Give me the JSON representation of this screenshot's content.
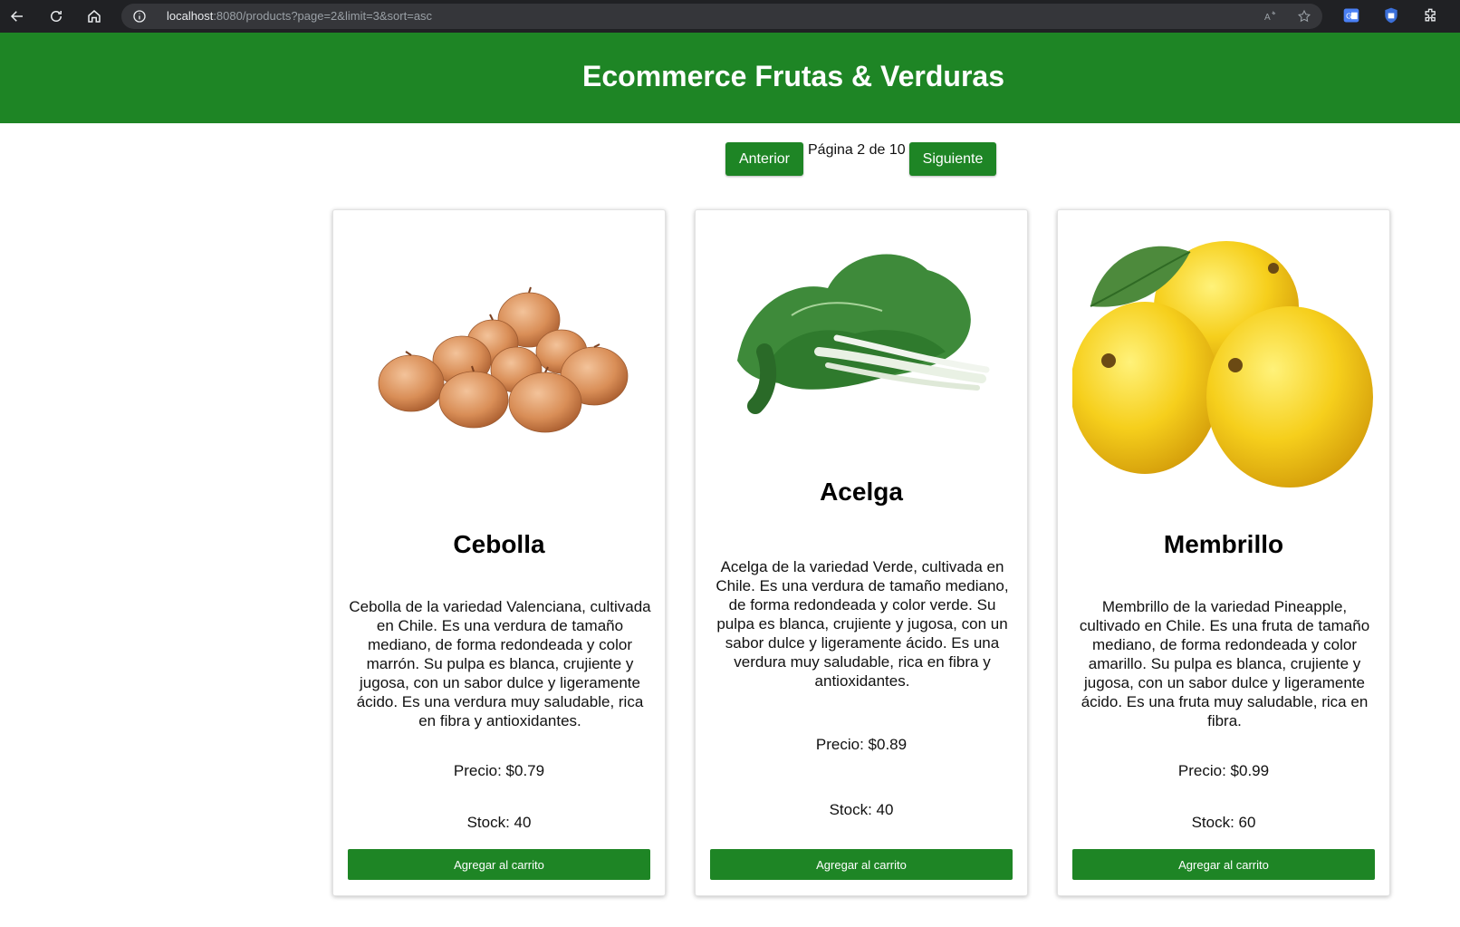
{
  "browser": {
    "url_host": "localhost",
    "url_rest": ":8080/products?page=2&limit=3&sort=asc"
  },
  "header": {
    "title": "Ecommerce Frutas & Verduras"
  },
  "pagination": {
    "prev_label": "Anterior",
    "page_label": "Página 2 de 10",
    "next_label": "Siguiente"
  },
  "products": [
    {
      "name": "Cebolla",
      "description": "Cebolla de la variedad Valenciana, cultivada en Chile. Es una verdura de tamaño mediano, de forma redondeada y color marrón. Su pulpa es blanca, crujiente y jugosa, con un sabor dulce y ligeramente ácido. Es una verdura muy saludable, rica en fibra y antioxidantes.",
      "price": "Precio: $0.79",
      "stock": "Stock: 40",
      "button": "Agregar al carrito"
    },
    {
      "name": "Acelga",
      "description": "Acelga de la variedad Verde, cultivada en Chile. Es una verdura de tamaño mediano, de forma redondeada y color verde. Su pulpa es blanca, crujiente y jugosa, con un sabor dulce y ligeramente ácido. Es una verdura muy saludable, rica en fibra y antioxidantes.",
      "price": "Precio: $0.89",
      "stock": "Stock: 40",
      "button": "Agregar al carrito"
    },
    {
      "name": "Membrillo",
      "description": "Membrillo de la variedad Pineapple, cultivado en Chile. Es una fruta de tamaño mediano, de forma redondeada y color amarillo. Su pulpa es blanca, crujiente y jugosa, con un sabor dulce y ligeramente ácido. Es una fruta muy saludable, rica en fibra.",
      "price": "Precio: $0.99",
      "stock": "Stock: 60",
      "button": "Agregar al carrito"
    }
  ],
  "colors": {
    "brand_green": "#1e8525",
    "browser_bg": "#202124"
  },
  "icons": [
    "back-icon",
    "reload-icon",
    "home-icon",
    "info-icon",
    "read-aloud-icon",
    "favorite-star-icon",
    "translate-extension-icon",
    "shield-extension-icon",
    "extensions-puzzle-icon"
  ]
}
